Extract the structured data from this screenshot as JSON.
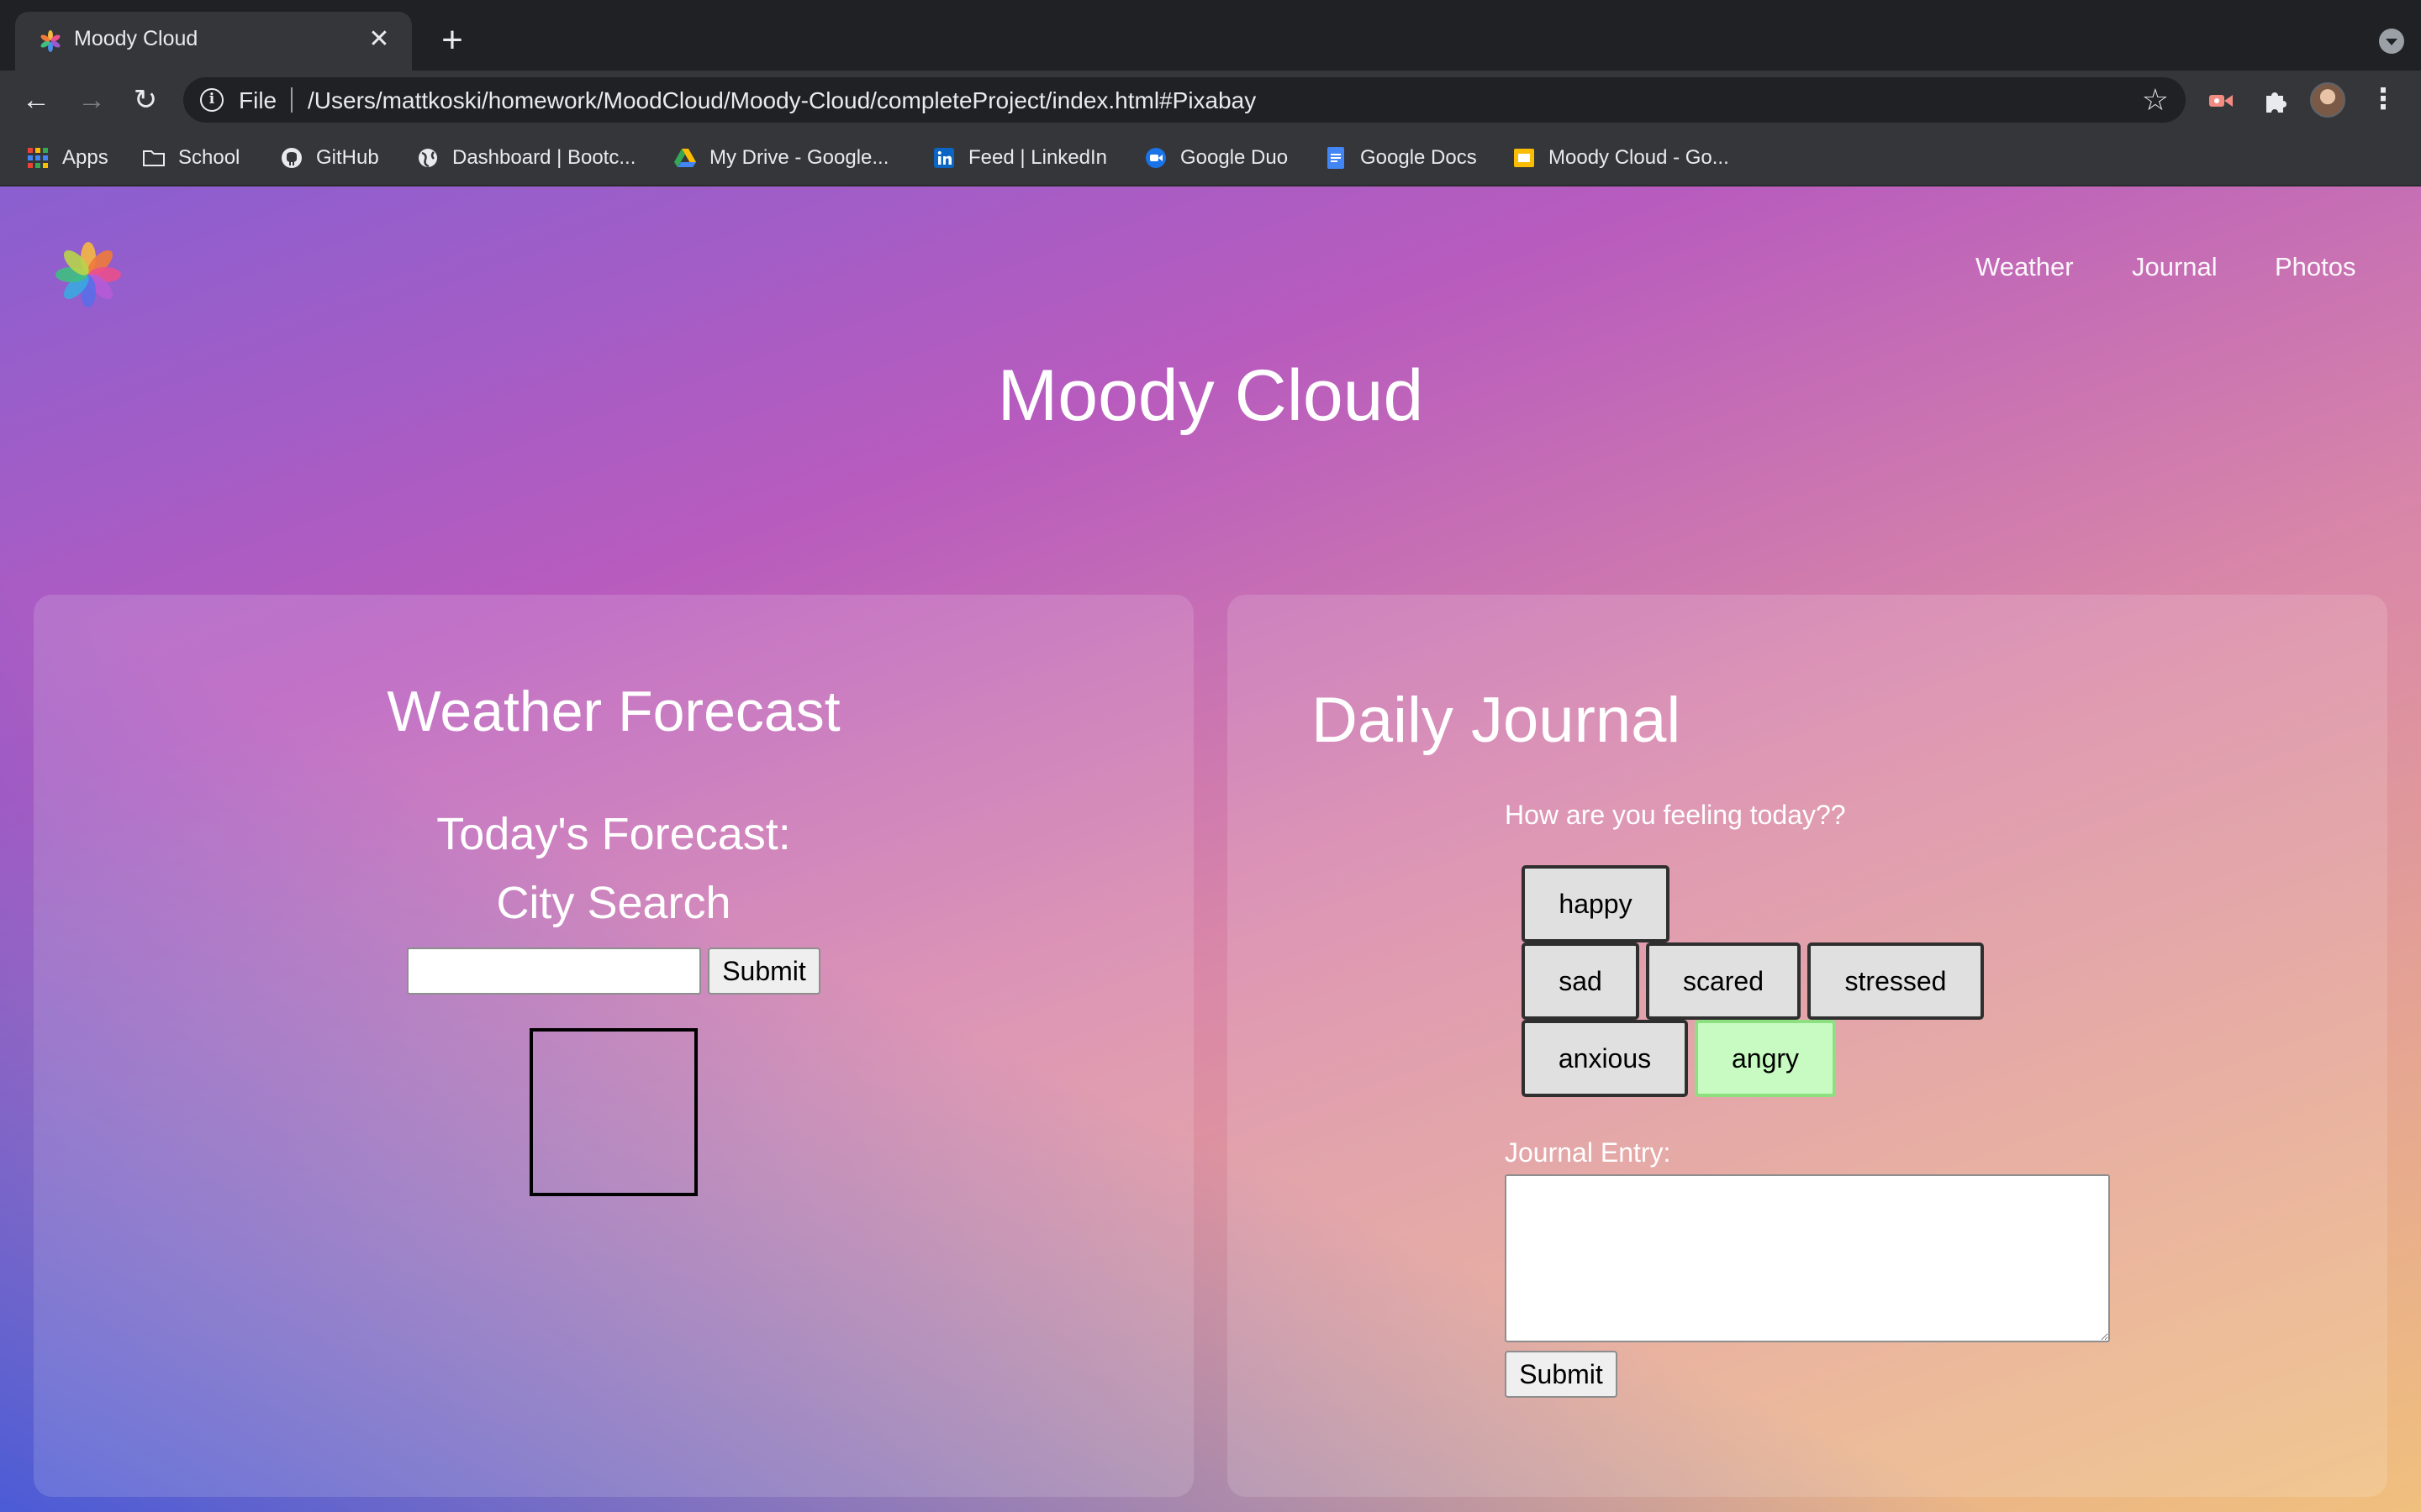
{
  "browser": {
    "tab": {
      "title": "Moody Cloud",
      "close": "✕",
      "new_tab": "+"
    },
    "toolbar": {
      "back": "←",
      "forward": "→",
      "reload": "↻",
      "scheme": "File",
      "url": "/Users/mattkoski/homework/MoodCloud/Moody-Cloud/completeProject/index.html#Pixabay",
      "star": "☆",
      "menu": "⋮"
    },
    "bookmarks": [
      {
        "label": "Apps",
        "icon": "apps-grid-icon"
      },
      {
        "label": "School",
        "icon": "folder-icon"
      },
      {
        "label": "GitHub",
        "icon": "github-icon"
      },
      {
        "label": "Dashboard | Bootc...",
        "icon": "globe-icon"
      },
      {
        "label": "My Drive - Google...",
        "icon": "google-drive-icon"
      },
      {
        "label": "Feed | LinkedIn",
        "icon": "linkedin-icon"
      },
      {
        "label": "Google Duo",
        "icon": "google-duo-icon"
      },
      {
        "label": "Google Docs",
        "icon": "google-docs-icon"
      },
      {
        "label": "Moody Cloud - Go...",
        "icon": "google-slides-icon"
      }
    ]
  },
  "site": {
    "nav": {
      "weather": "Weather",
      "journal": "Journal",
      "photos": "Photos"
    },
    "title": "Moody Cloud",
    "weather": {
      "heading": "Weather Forecast",
      "today": "Today's Forecast:",
      "city_search": "City Search",
      "city_value": "",
      "submit": "Submit"
    },
    "journal": {
      "heading": "Daily Journal",
      "prompt": "How are you feeling today??",
      "moods": [
        "happy",
        "sad",
        "scared",
        "stressed",
        "anxious",
        "angry"
      ],
      "selected_mood": "angry",
      "entry_label": "Journal Entry:",
      "entry_value": "",
      "submit": "Submit"
    }
  },
  "colors": {
    "selected_mood_bg": "#c8fbc2",
    "gradient_start": "#8a5fd0",
    "gradient_mid": "#b85bbe",
    "gradient_end": "#f0c07e"
  }
}
